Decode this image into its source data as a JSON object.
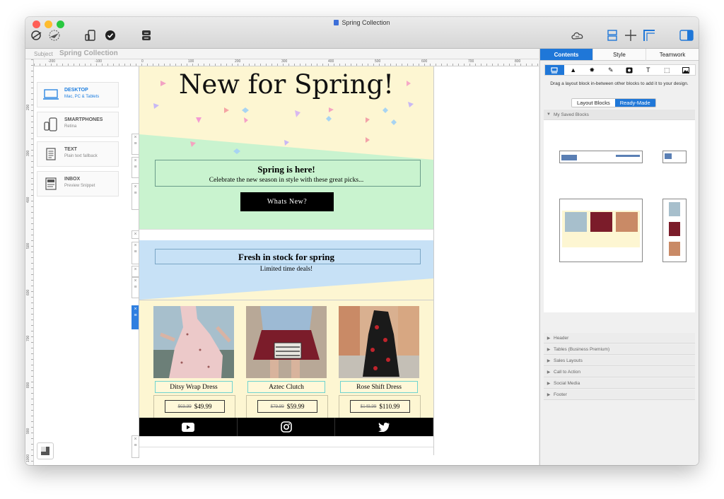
{
  "window": {
    "title": "Spring Collection",
    "traffic_colors": [
      "#ff5f57",
      "#febc2e",
      "#28c840"
    ]
  },
  "subject": {
    "label": "Subject",
    "value": "Spring Collection"
  },
  "rulers": {
    "h_labels": [
      "-200",
      "-100",
      "0",
      "100",
      "200",
      "300",
      "400",
      "500",
      "600",
      "700",
      "800"
    ],
    "v_labels": [
      "200",
      "300",
      "400",
      "500",
      "600",
      "700",
      "800",
      "900",
      "1000"
    ]
  },
  "devices": [
    {
      "title": "DESKTOP",
      "subtitle": "Mac, PC & Tablets",
      "icon": "monitor-icon",
      "active": true
    },
    {
      "title": "SMARTPHONES",
      "subtitle": "Retina",
      "icon": "phone-icon",
      "active": false
    },
    {
      "title": "TEXT",
      "subtitle": "Plain text fallback",
      "icon": "document-icon",
      "active": false
    },
    {
      "title": "INBOX",
      "subtitle": "Preview Snippet",
      "icon": "inbox-icon",
      "active": false
    }
  ],
  "email": {
    "headline": "New for Spring!",
    "block1": {
      "title": "Spring is here!",
      "subtitle": "Celebrate the new season in style with these great picks...",
      "button": "Whats New?"
    },
    "block2": {
      "title": "Fresh in stock for spring",
      "subtitle": "Limited time deals!"
    },
    "products": [
      {
        "name": "Ditsy Wrap Dress",
        "old_price": "$69.99",
        "price": "$49.99"
      },
      {
        "name": "Aztec Clutch",
        "old_price": "$79.99",
        "price": "$59.99"
      },
      {
        "name": "Rose Shift Dress",
        "old_price": "$149.99",
        "price": "$110.99"
      }
    ],
    "social": [
      "youtube-icon",
      "instagram-icon",
      "twitter-icon"
    ],
    "colors": {
      "cream": "#fdf6d2",
      "mint": "#c9f3cf",
      "sky": "#c7e1f6",
      "blue_accent": "#1f77d8"
    }
  },
  "panel": {
    "tabs": [
      "Contents",
      "Style",
      "Teamwork"
    ],
    "hint": "Drag a layout block in-between other blocks to add it to your design.",
    "segments": [
      "Layout Blocks",
      "Ready-Made"
    ],
    "saved_header": "My Saved Blocks",
    "sections": [
      "Header",
      "Tables (Business Premium)",
      "Sales Layouts",
      "Call to Action",
      "Social Media",
      "Footer"
    ]
  }
}
